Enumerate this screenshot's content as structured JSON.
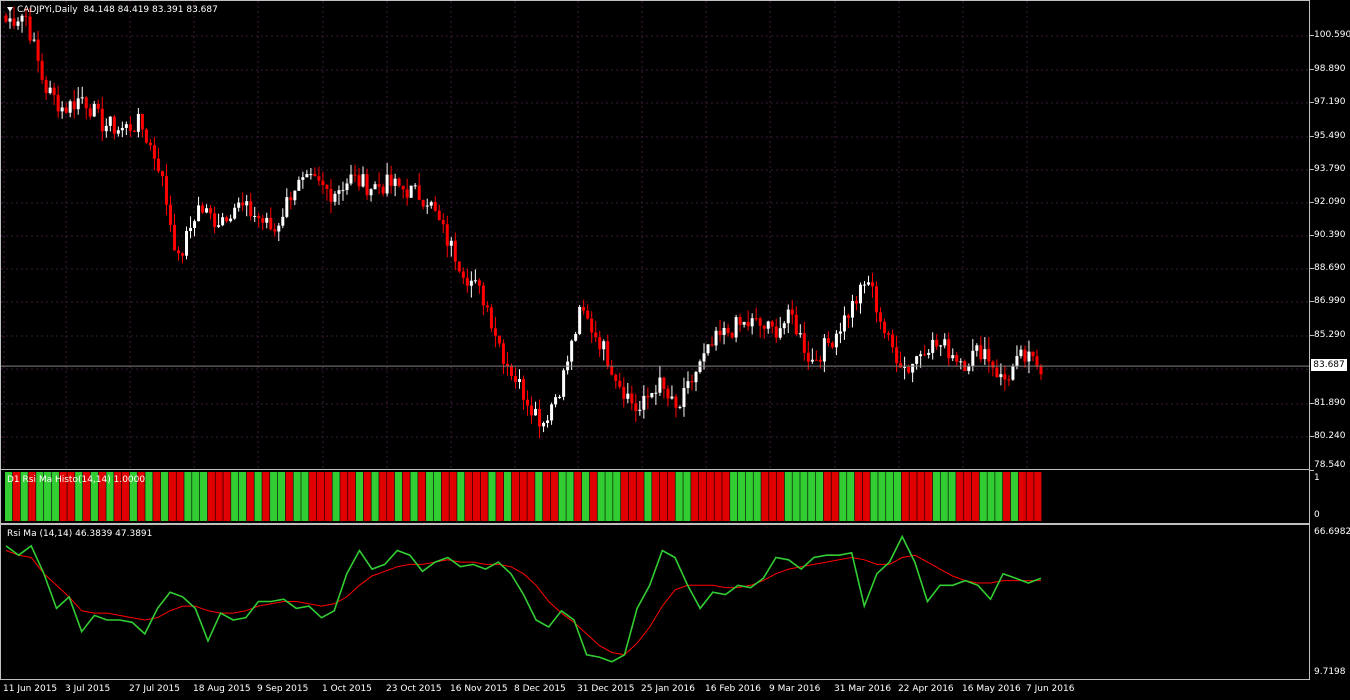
{
  "chart_header": {
    "symbol": "CADJPYi,Daily",
    "ohlc": "84.148 84.419 83.391 83.687"
  },
  "price_axis": [
    "100.590",
    "98.890",
    "97.190",
    "95.490",
    "93.790",
    "92.090",
    "90.390",
    "88.690",
    "86.990",
    "85.290",
    "81.890",
    "80.240",
    "78.540"
  ],
  "current_price": "83.687",
  "histo_panel": {
    "label": "D1 Rsi Ma Histo(14,14) 1.0000",
    "axis_top": "1",
    "axis_bottom": "0"
  },
  "rsi_panel": {
    "label": "Rsi Ma (14,14) 46.3839 47.3891",
    "axis_top": "66.6982",
    "axis_bottom": "9.7198"
  },
  "time_axis": [
    "11 Jun 2015",
    "3 Jul 2015",
    "27 Jul 2015",
    "18 Aug 2015",
    "9 Sep 2015",
    "1 Oct 2015",
    "23 Oct 2015",
    "16 Nov 2015",
    "8 Dec 2015",
    "31 Dec 2015",
    "25 Jan 2016",
    "16 Feb 2016",
    "9 Mar 2016",
    "31 Mar 2016",
    "22 Apr 2016",
    "16 May 2016",
    "7 Jun 2016"
  ],
  "colors": {
    "bull": "#ffffff",
    "bear": "#ff0000",
    "histo_up": "#32cd32",
    "histo_down": "#e00000",
    "rsi_line": "#32cd32",
    "rsi_ma": "#ff0000",
    "grid": "#3a1a3a"
  },
  "chart_data": [
    {
      "type": "candlestick",
      "title": "CADJPYi,Daily",
      "ylim": [
        78.54,
        101.6
      ],
      "close_path": [
        [
          "11 Jun 2015",
          100.6
        ],
        [
          "22 Jun 2015",
          101.0
        ],
        [
          "3 Jul 2015",
          97.4
        ],
        [
          "10 Jul 2015",
          96.3
        ],
        [
          "15 Jul 2015",
          96.9
        ],
        [
          "27 Jul 2015",
          95.6
        ],
        [
          "5 Aug 2015",
          95.3
        ],
        [
          "13 Aug 2015",
          95.6
        ],
        [
          "18 Aug 2015",
          93.5
        ],
        [
          "24 Aug 2015",
          88.8
        ],
        [
          "27 Aug 2015",
          91.5
        ],
        [
          "2 Sep 2015",
          90.8
        ],
        [
          "9 Sep 2015",
          91.6
        ],
        [
          "16 Sep 2015",
          91.1
        ],
        [
          "25 Sep 2015",
          90.3
        ],
        [
          "1 Oct 2015",
          92.5
        ],
        [
          "9 Oct 2015",
          92.7
        ],
        [
          "16 Oct 2015",
          92.2
        ],
        [
          "23 Oct 2015",
          92.9
        ],
        [
          "3 Nov 2015",
          92.5
        ],
        [
          "10 Nov 2015",
          92.6
        ],
        [
          "16 Nov 2015",
          92.3
        ],
        [
          "23 Nov 2015",
          91.9
        ],
        [
          "1 Dec 2015",
          89.9
        ],
        [
          "8 Dec 2015",
          88.2
        ],
        [
          "15 Dec 2015",
          86.9
        ],
        [
          "21 Dec 2015",
          84.1
        ],
        [
          "28 Dec 2015",
          82.4
        ],
        [
          "31 Dec 2015",
          80.9
        ],
        [
          "7 Jan 2016",
          82.9
        ],
        [
          "14 Jan 2016",
          86.4
        ],
        [
          "20 Jan 2016",
          84.9
        ],
        [
          "25 Jan 2016",
          82.9
        ],
        [
          "29 Jan 2016",
          81.4
        ],
        [
          "3 Feb 2016",
          82.9
        ],
        [
          "10 Feb 2016",
          81.4
        ],
        [
          "16 Feb 2016",
          83.4
        ],
        [
          "22 Feb 2016",
          84.9
        ],
        [
          "29 Feb 2016",
          85.6
        ],
        [
          "9 Mar 2016",
          85.8
        ],
        [
          "16 Mar 2016",
          85.4
        ],
        [
          "24 Mar 2016",
          86.1
        ],
        [
          "31 Mar 2016",
          83.9
        ],
        [
          "7 Apr 2016",
          84.9
        ],
        [
          "14 Apr 2016",
          86.4
        ],
        [
          "22 Apr 2016",
          87.9
        ],
        [
          "27 Apr 2016",
          84.9
        ],
        [
          "3 May 2016",
          83.5
        ],
        [
          "9 May 2016",
          84.8
        ],
        [
          "16 May 2016",
          84.6
        ],
        [
          "23 May 2016",
          83.9
        ],
        [
          "30 May 2016",
          84.6
        ],
        [
          "3 Jun 2016",
          82.9
        ],
        [
          "7 Jun 2016",
          84.1
        ],
        [
          "9 Jun 2016",
          83.7
        ]
      ]
    },
    {
      "type": "bar",
      "title": "D1 Rsi Ma Histo(14,14) 1.0000",
      "ylim": [
        0,
        1
      ],
      "series": [
        {
          "values": [
            1,
            0,
            1,
            0,
            1,
            1,
            1,
            0,
            0,
            1,
            0,
            1,
            0,
            1,
            0,
            0,
            1,
            0,
            1,
            0,
            1,
            0,
            0,
            1,
            1,
            1,
            0,
            0,
            0,
            1,
            1,
            0,
            1,
            0,
            1,
            1,
            0,
            1,
            1,
            0,
            0,
            0,
            1,
            0,
            0,
            1,
            0,
            1,
            0,
            0,
            1,
            0,
            1,
            0,
            1,
            1,
            0,
            0,
            1,
            0,
            0,
            0,
            1,
            0,
            1,
            0,
            0,
            0,
            1,
            0,
            0,
            1,
            1,
            0,
            1,
            0,
            1,
            1,
            1,
            0,
            0,
            0,
            1,
            0,
            0,
            0,
            1,
            1,
            0,
            0,
            0,
            0,
            0,
            1,
            1,
            1,
            1,
            0,
            0,
            0,
            1,
            1,
            1,
            1,
            1,
            0,
            0,
            1,
            1,
            0,
            0,
            1,
            1,
            1,
            1,
            0,
            0,
            0,
            0,
            1,
            1,
            1,
            0,
            0,
            0,
            1,
            1,
            1,
            0,
            1,
            0,
            0,
            0
          ]
        }
      ]
    },
    {
      "type": "line",
      "title": "Rsi Ma (14,14) 46.3839 47.3891",
      "ylim": [
        9.7198,
        66.6982
      ],
      "series": [
        {
          "values": [
            62,
            58,
            62,
            50,
            35,
            40,
            25,
            32,
            30,
            30,
            29,
            24,
            35,
            42,
            40,
            35,
            21,
            33,
            30,
            31,
            38,
            38,
            39,
            35,
            36,
            31,
            34,
            50,
            60,
            52,
            54,
            60,
            58,
            51,
            55,
            57,
            53,
            54,
            52,
            55,
            50,
            41,
            30,
            27,
            34,
            30,
            15,
            14,
            12,
            15,
            35,
            45,
            60,
            57,
            45,
            35,
            42,
            41,
            45,
            44,
            48,
            57,
            56,
            52,
            57,
            58,
            58,
            59,
            36,
            50,
            55,
            66,
            55,
            38,
            45,
            45,
            47,
            45,
            39,
            50,
            48,
            46,
            48
          ]
        },
        {
          "values": [
            60,
            58,
            57,
            50,
            45,
            40,
            34,
            33,
            33,
            32,
            31,
            30,
            31,
            34,
            36,
            36,
            34,
            33,
            33,
            34,
            36,
            37,
            38,
            38,
            37,
            36,
            37,
            40,
            45,
            49,
            51,
            53,
            54,
            54,
            55,
            56,
            55,
            55,
            54,
            54,
            53,
            50,
            45,
            38,
            33,
            29,
            24,
            19,
            16,
            15,
            20,
            27,
            36,
            43,
            45,
            45,
            45,
            44,
            44,
            45,
            47,
            50,
            52,
            53,
            54,
            55,
            56,
            57,
            56,
            54,
            54,
            57,
            58,
            55,
            52,
            49,
            47,
            46,
            46,
            47,
            47,
            47,
            47
          ]
        }
      ]
    }
  ]
}
